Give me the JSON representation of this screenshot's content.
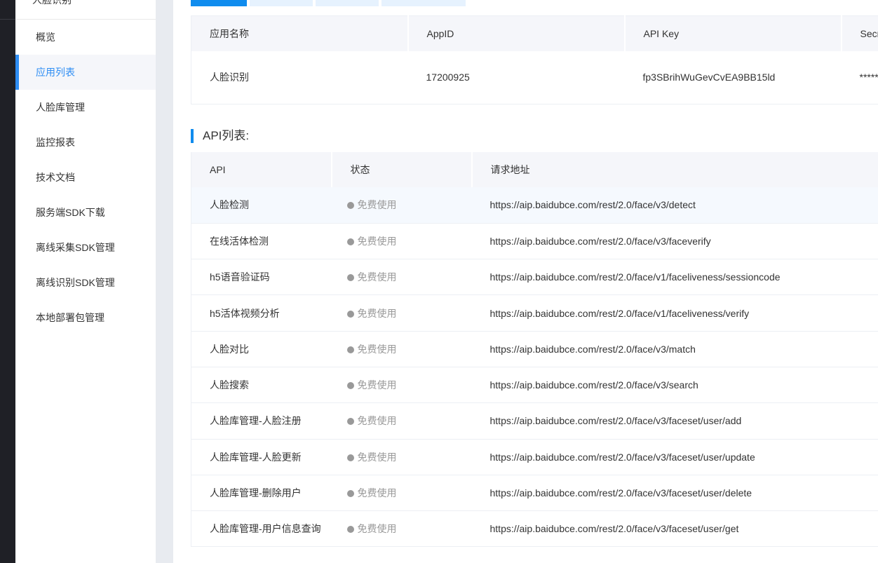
{
  "sidebar": {
    "header": "人脸识别",
    "items": [
      {
        "label": "概览"
      },
      {
        "label": "应用列表",
        "active": true
      },
      {
        "label": "人脸库管理"
      },
      {
        "label": "监控报表"
      },
      {
        "label": "技术文档"
      },
      {
        "label": "服务端SDK下载"
      },
      {
        "label": "离线采集SDK管理"
      },
      {
        "label": "离线识别SDK管理"
      },
      {
        "label": "本地部署包管理"
      }
    ]
  },
  "app_table": {
    "headers": [
      "应用名称",
      "AppID",
      "API Key",
      "Secr"
    ],
    "row": [
      "人脸识别",
      "17200925",
      "fp3SBrihWuGevCvEA9BB15ld",
      "******"
    ]
  },
  "api_section": {
    "title": "API列表:",
    "headers": [
      "API",
      "状态",
      "请求地址"
    ],
    "rows": [
      [
        "人脸检测",
        "免费使用",
        "https://aip.baidubce.com/rest/2.0/face/v3/detect"
      ],
      [
        "在线活体检测",
        "免费使用",
        "https://aip.baidubce.com/rest/2.0/face/v3/faceverify"
      ],
      [
        "h5语音验证码",
        "免费使用",
        "https://aip.baidubce.com/rest/2.0/face/v1/faceliveness/sessioncode"
      ],
      [
        "h5活体视频分析",
        "免费使用",
        "https://aip.baidubce.com/rest/2.0/face/v1/faceliveness/verify"
      ],
      [
        "人脸对比",
        "免费使用",
        "https://aip.baidubce.com/rest/2.0/face/v3/match"
      ],
      [
        "人脸搜索",
        "免费使用",
        "https://aip.baidubce.com/rest/2.0/face/v3/search"
      ],
      [
        "人脸库管理-人脸注册",
        "免费使用",
        "https://aip.baidubce.com/rest/2.0/face/v3/faceset/user/add"
      ],
      [
        "人脸库管理-人脸更新",
        "免费使用",
        "https://aip.baidubce.com/rest/2.0/face/v3/faceset/user/update"
      ],
      [
        "人脸库管理-删除用户",
        "免费使用",
        "https://aip.baidubce.com/rest/2.0/face/v3/faceset/user/delete"
      ],
      [
        "人脸库管理-用户信息查询",
        "免费使用",
        "https://aip.baidubce.com/rest/2.0/face/v3/faceset/user/get"
      ]
    ]
  },
  "colors": {
    "accent": "#108cee",
    "status_dot": "#999999"
  }
}
